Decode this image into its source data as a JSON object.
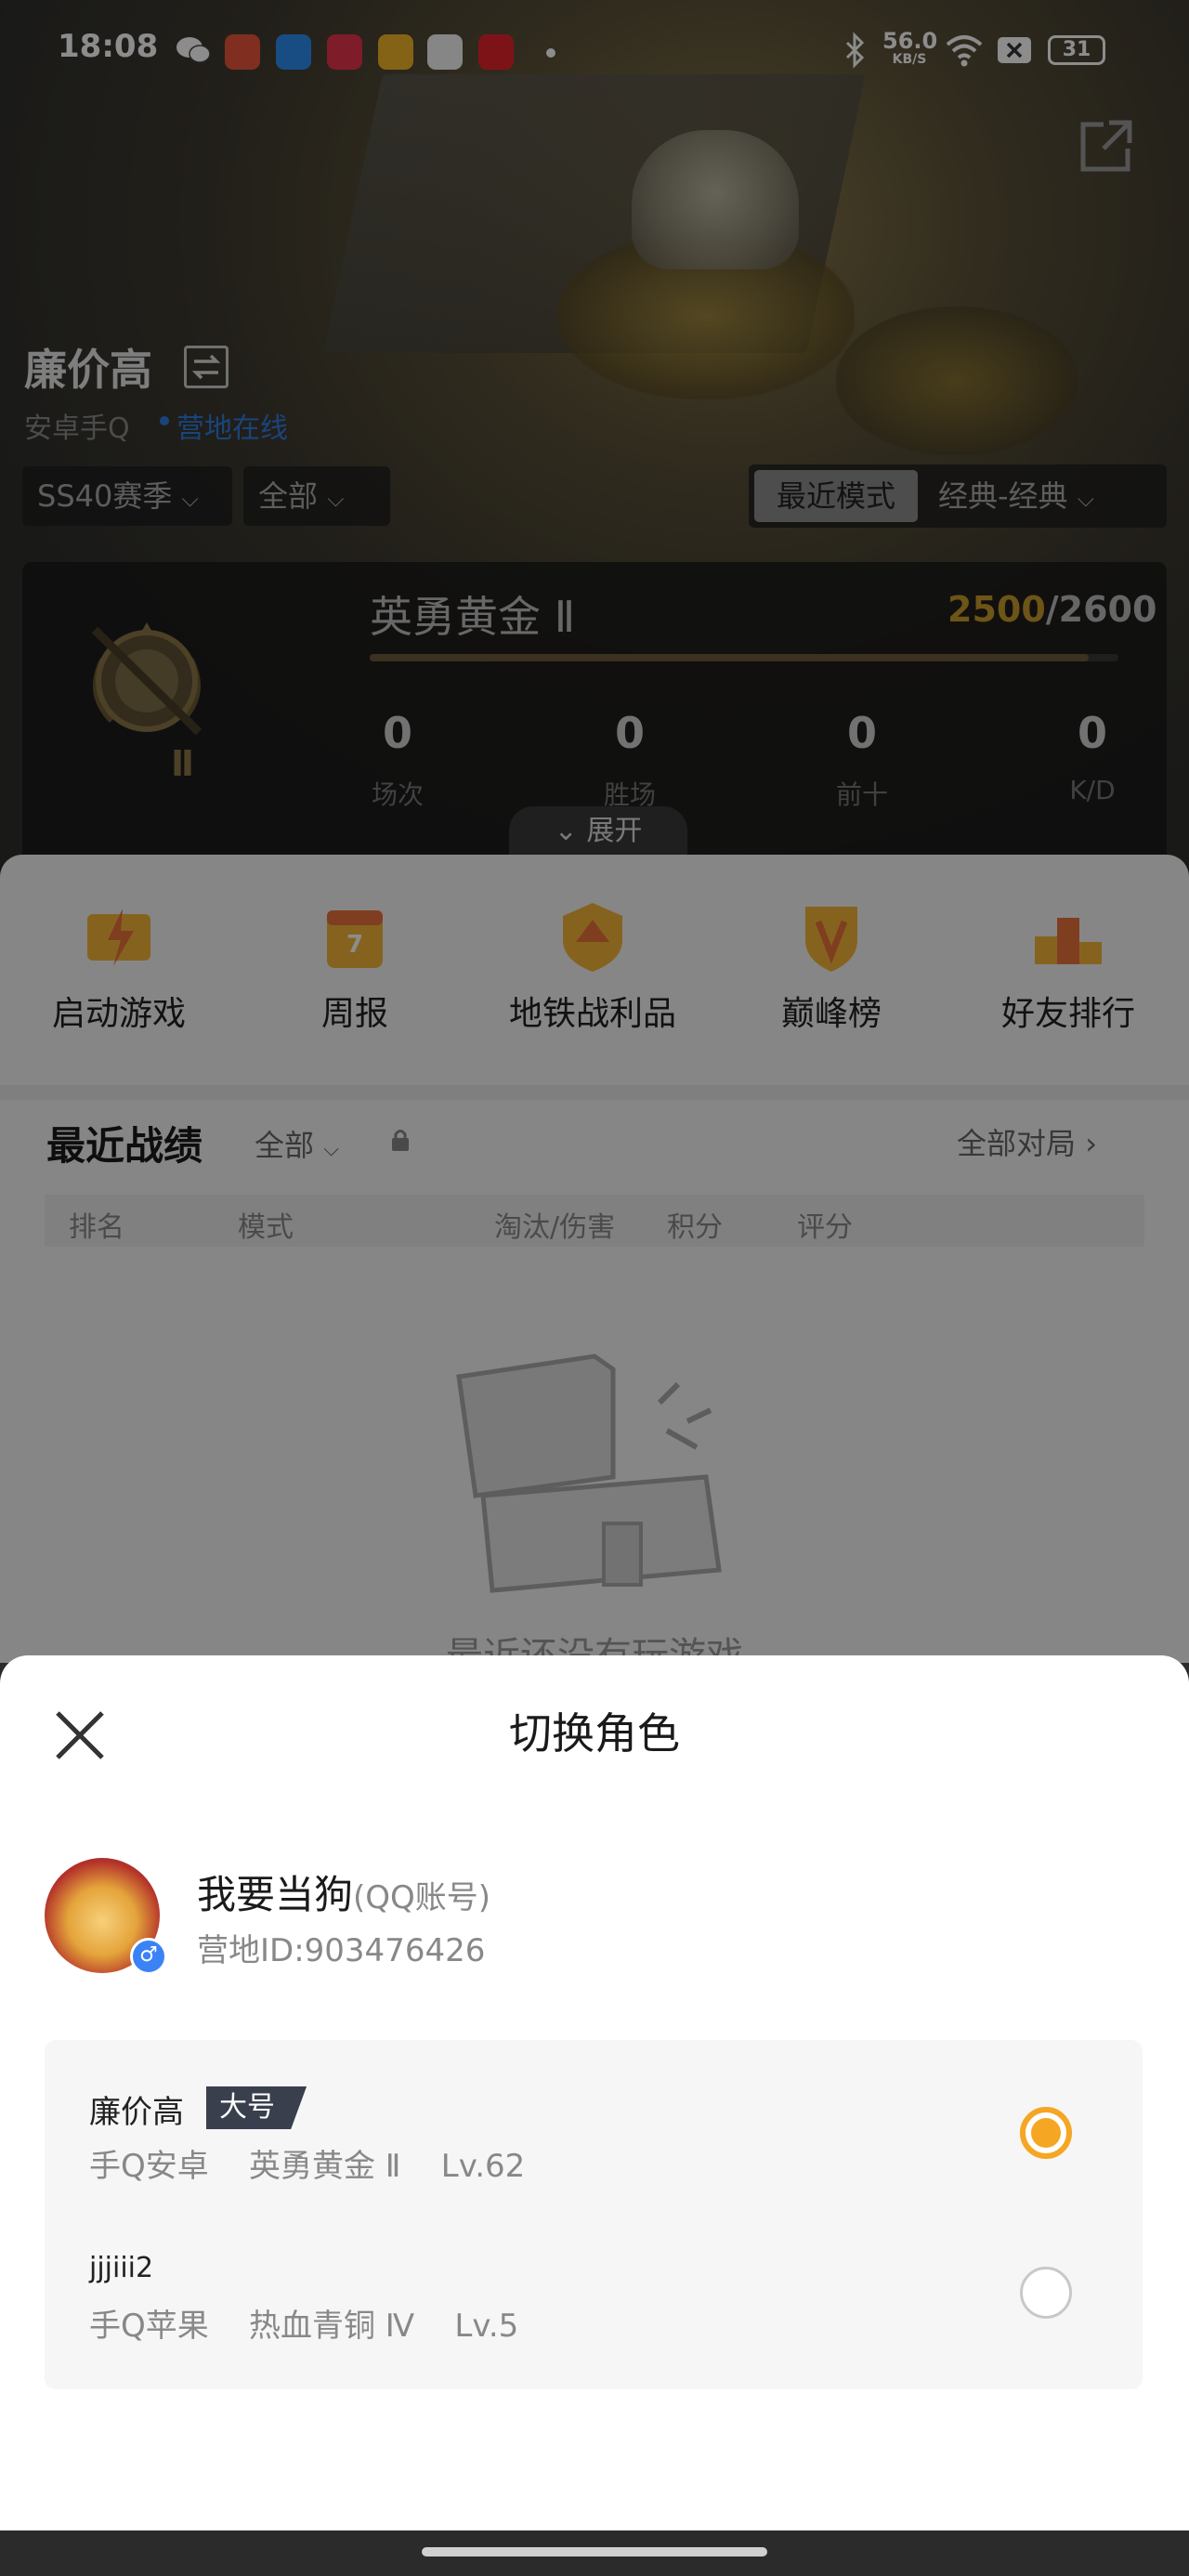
{
  "status_bar": {
    "time": "18:08",
    "speed_value": "56.0",
    "speed_unit": "KB/S",
    "battery": "31"
  },
  "profile": {
    "name": "廉价高",
    "platform": "安卓手Q",
    "online_status": "营地在线",
    "season_filter": "SS40赛季",
    "all_filter": "全部",
    "mode_label": "最近模式",
    "mode_value": "经典-经典"
  },
  "rank": {
    "title": "英勇黄金 Ⅱ",
    "points_current": "2500",
    "points_total": "/2600",
    "badge_numeral": "Ⅱ",
    "progress": 0.96,
    "stats": [
      {
        "value": "0",
        "label": "场次"
      },
      {
        "value": "0",
        "label": "胜场"
      },
      {
        "value": "0",
        "label": "前十"
      },
      {
        "value": "0",
        "label": "K/D"
      }
    ],
    "expand_label": "展开"
  },
  "functions": [
    {
      "label": "启动游戏",
      "icon": "lightning-icon"
    },
    {
      "label": "周报",
      "icon": "calendar-icon",
      "badge": "7"
    },
    {
      "label": "地铁战利品",
      "icon": "shield-loot-icon"
    },
    {
      "label": "巅峰榜",
      "icon": "peak-badge-icon"
    },
    {
      "label": "好友排行",
      "icon": "podium-icon"
    }
  ],
  "records": {
    "title": "最近战绩",
    "filter": "全部",
    "all_matches": "全部对局",
    "columns": [
      "排名",
      "模式",
      "淘汰/伤害",
      "积分",
      "评分"
    ],
    "empty_text": "最近还没有玩游戏"
  },
  "sheet": {
    "title": "切换角色",
    "account_name": "我要当狗",
    "account_type": "(QQ账号)",
    "camp_id": "营地ID:903476426",
    "roles": [
      {
        "name": "廉价高",
        "tag": "大号",
        "platform": "手Q安卓",
        "rank": "英勇黄金 Ⅱ",
        "level": "Lv.62",
        "selected": true
      },
      {
        "name": "jjjiii2",
        "tag": "",
        "platform": "手Q苹果",
        "rank": "热血青铜 Ⅳ",
        "level": "Lv.5",
        "selected": false
      }
    ]
  },
  "colors": {
    "accent_gold": "#f5a623",
    "points_gold": "#c79a2a",
    "online_blue": "#2f7de1"
  }
}
